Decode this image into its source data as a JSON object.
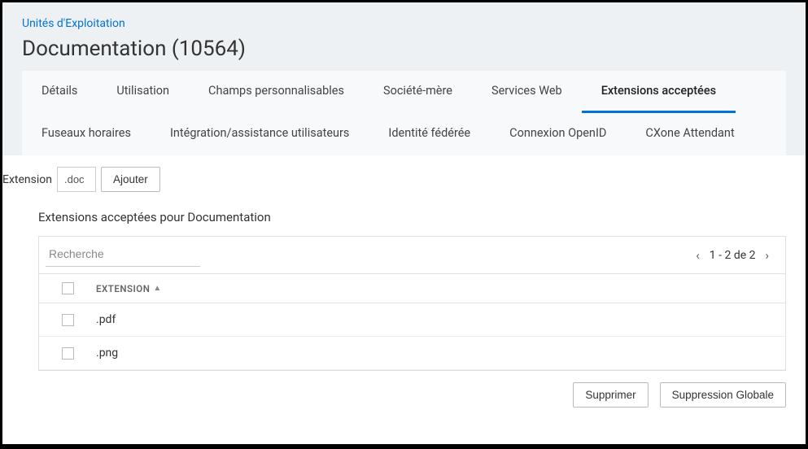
{
  "breadcrumb": "Unités d'Exploitation",
  "page_title": "Documentation (10564)",
  "tabs": [
    {
      "label": "Détails"
    },
    {
      "label": "Utilisation"
    },
    {
      "label": "Champs personnalisables"
    },
    {
      "label": "Société-mère"
    },
    {
      "label": "Services Web"
    },
    {
      "label": "Extensions acceptées"
    },
    {
      "label": "Fuseaux horaires"
    },
    {
      "label": "Intégration/assistance utilisateurs"
    },
    {
      "label": "Identité fédérée"
    },
    {
      "label": "Connexion OpenID"
    },
    {
      "label": "CXone Attendant"
    }
  ],
  "extension_field": {
    "label": "Extension",
    "value": ".doc",
    "add_button": "Ajouter"
  },
  "section_title": "Extensions acceptées pour Documentation",
  "search": {
    "placeholder": "Recherche"
  },
  "pagination": {
    "text": "1 - 2 de 2"
  },
  "table": {
    "header_extension": "EXTENSION",
    "rows": [
      {
        "ext": ".pdf"
      },
      {
        "ext": ".png"
      }
    ]
  },
  "actions": {
    "delete": "Supprimer",
    "global_delete": "Suppression Globale"
  }
}
